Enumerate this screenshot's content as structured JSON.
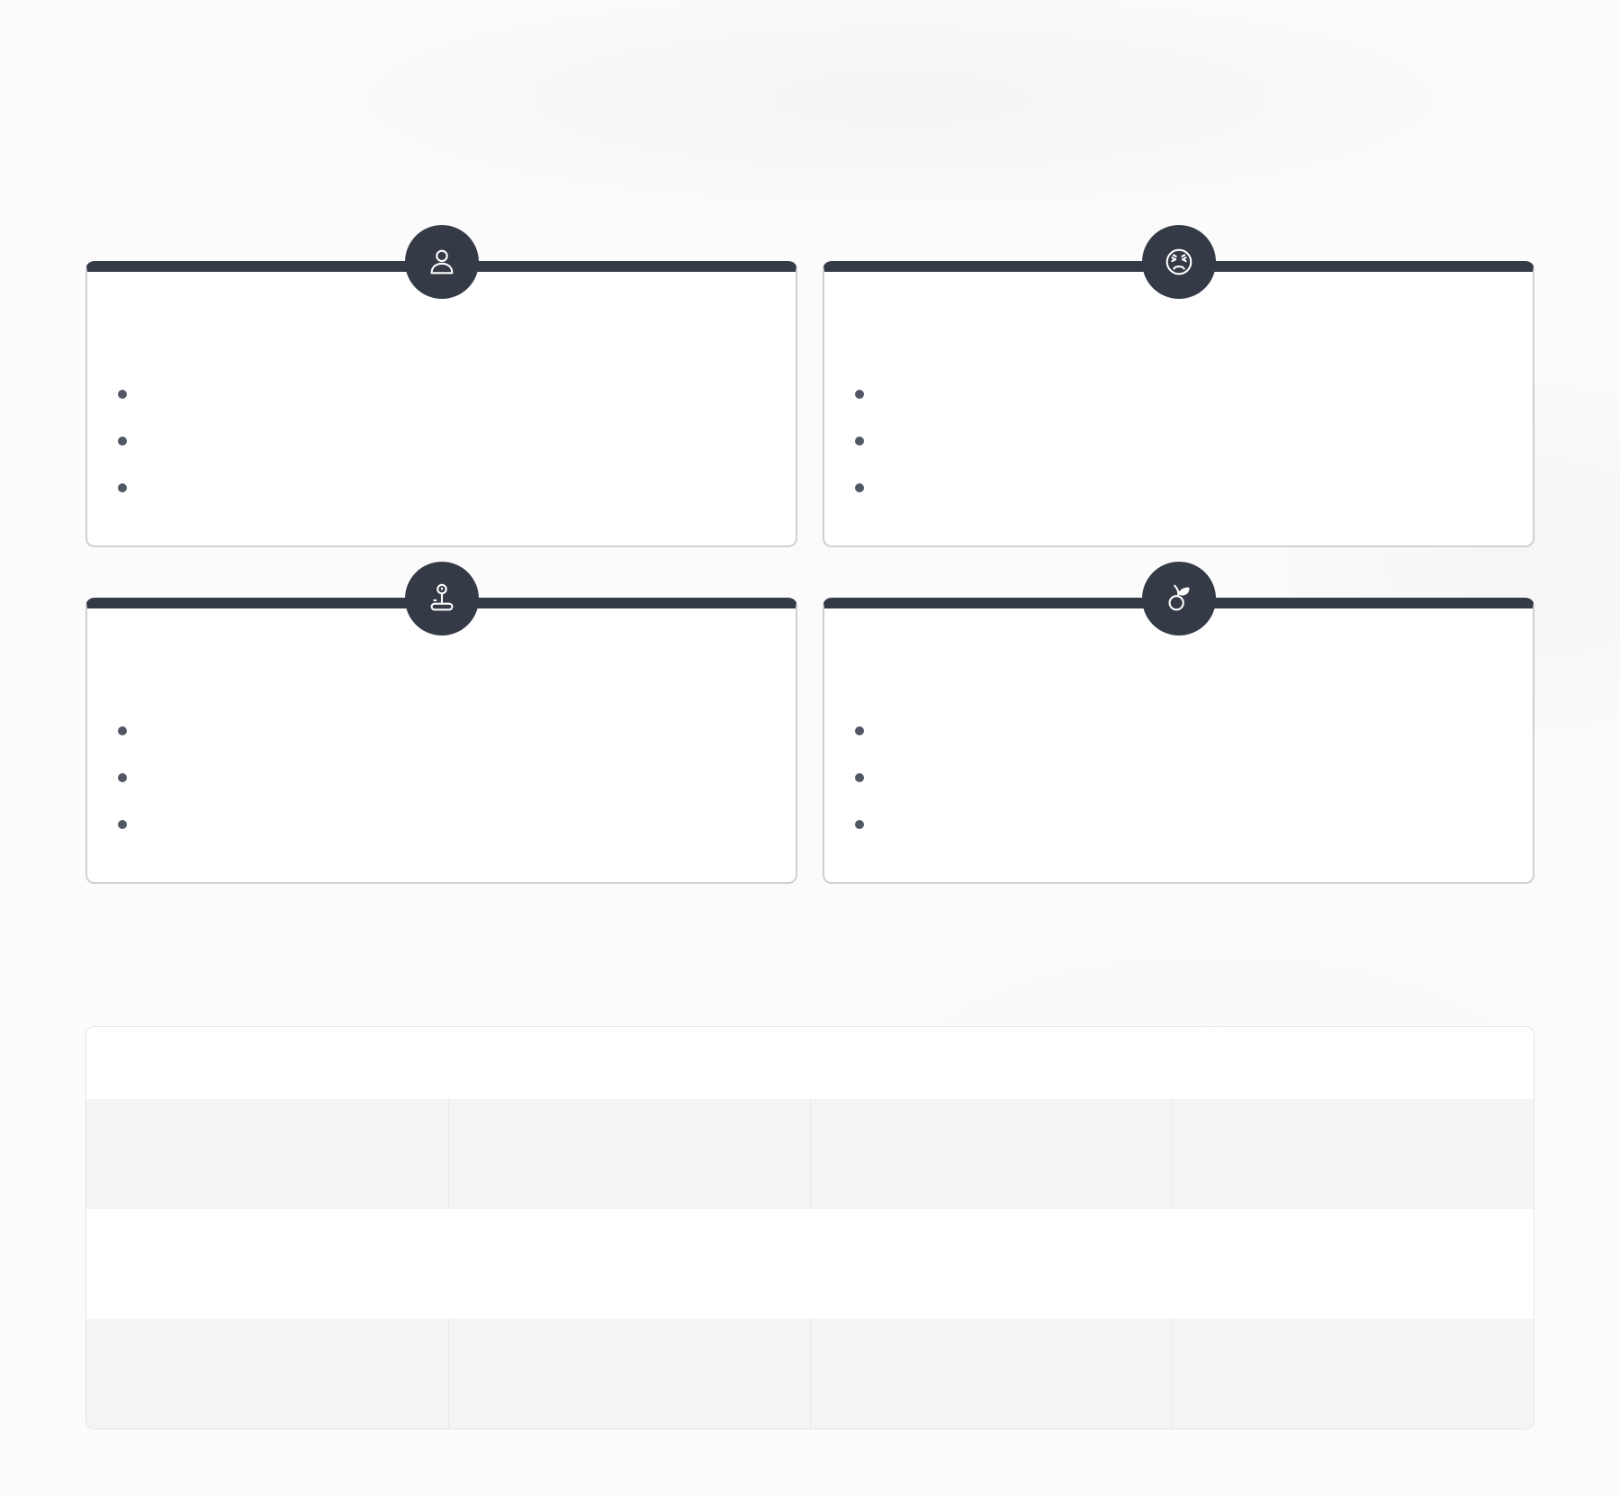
{
  "header": {
    "title": "",
    "subtitle": ""
  },
  "cards": [
    {
      "icon": "person-icon",
      "title": "",
      "items": [
        "",
        "",
        ""
      ]
    },
    {
      "icon": "frustrated-face-icon",
      "title": "",
      "items": [
        "",
        "",
        ""
      ]
    },
    {
      "icon": "joystick-icon",
      "title": "",
      "items": [
        "",
        "",
        ""
      ]
    },
    {
      "icon": "fruit-leaf-icon",
      "title": "",
      "items": [
        "",
        "",
        ""
      ]
    }
  ],
  "table": {
    "headers": [
      "",
      "",
      "",
      ""
    ],
    "rows": [
      [
        "",
        "",
        "",
        ""
      ],
      [
        "",
        "",
        "",
        ""
      ],
      [
        "",
        "",
        "",
        ""
      ]
    ]
  },
  "colors": {
    "accent_dark": "#353a47",
    "card_border": "#cfd0d3",
    "bullet": "#525766",
    "table_stripe": "#f4f4f5",
    "background": "#fbfbfb"
  }
}
